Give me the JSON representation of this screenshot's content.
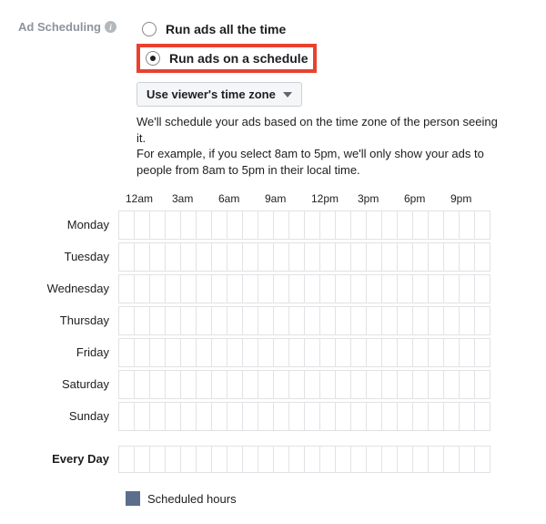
{
  "section_label": "Ad Scheduling",
  "radios": {
    "all_time": "Run ads all the time",
    "schedule": "Run ads on a schedule"
  },
  "timezone_select": "Use viewer's time zone",
  "description_line1": "We'll schedule your ads based on the time zone of the person seeing it.",
  "description_line2": "For example, if you select 8am to 5pm, we'll only show your ads to people from 8am to 5pm in their local time.",
  "time_headers": [
    "12am",
    "3am",
    "6am",
    "9am",
    "12pm",
    "3pm",
    "6pm",
    "9pm"
  ],
  "days": [
    "Monday",
    "Tuesday",
    "Wednesday",
    "Thursday",
    "Friday",
    "Saturday",
    "Sunday"
  ],
  "every_day_label": "Every Day",
  "legend_label": "Scheduled hours",
  "colors": {
    "highlight": "#e8412f",
    "legend": "#5b6e8c"
  }
}
